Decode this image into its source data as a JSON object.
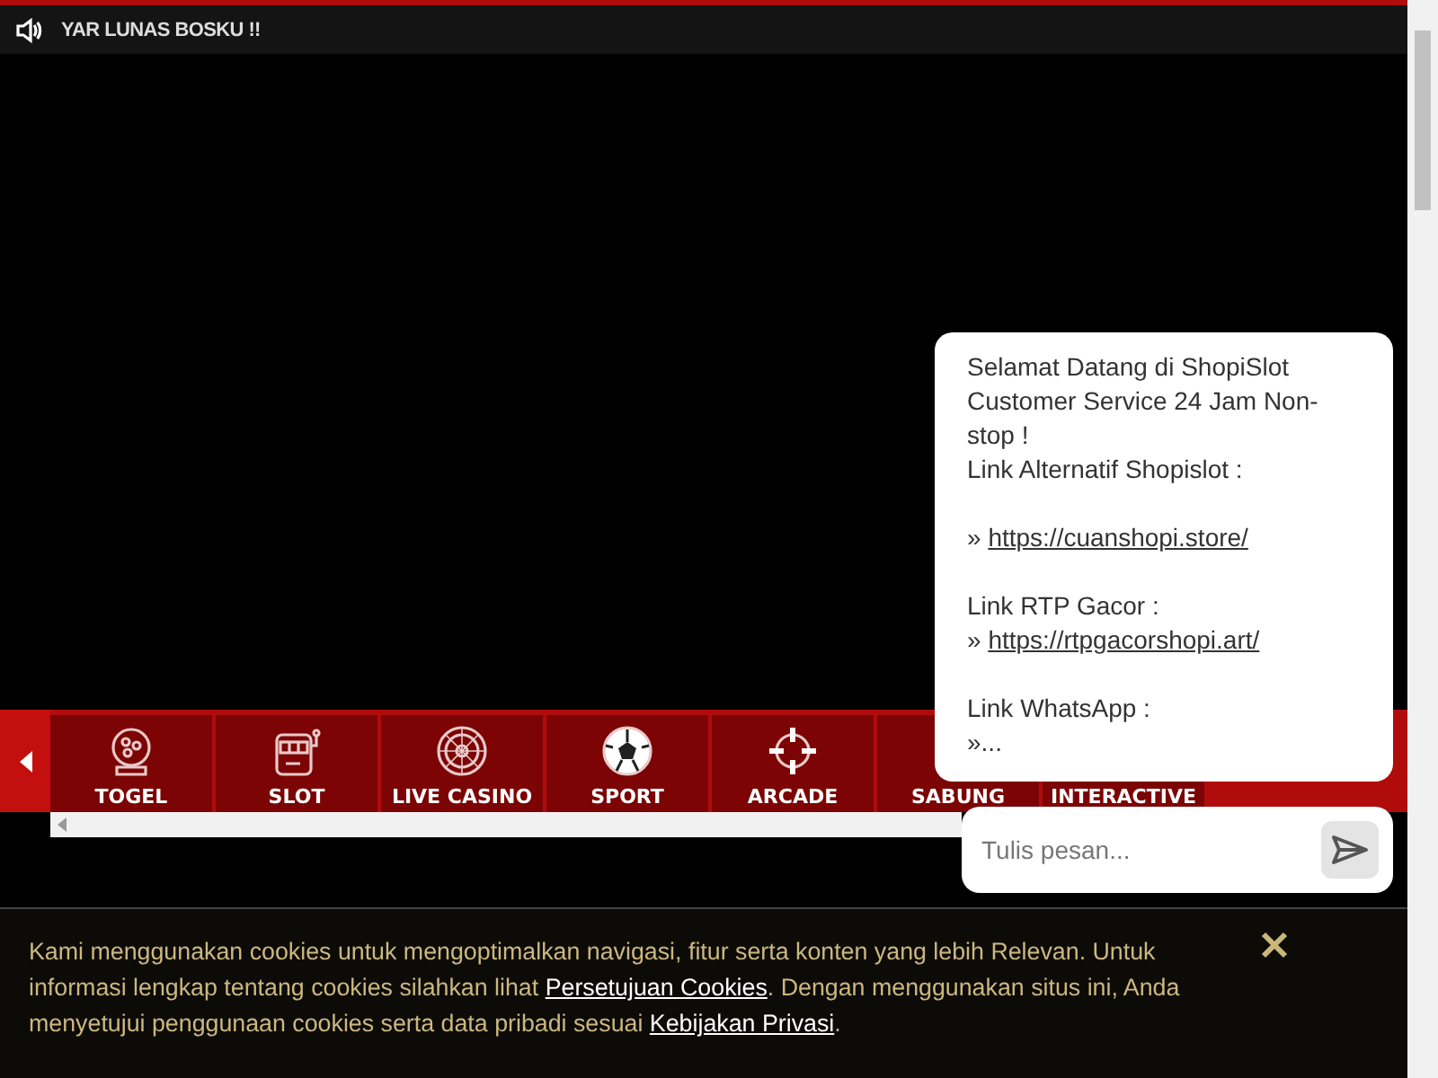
{
  "marquee": {
    "text": "YAR LUNAS BOSKU !!"
  },
  "categories": [
    {
      "kind": "togel",
      "label": "TOGEL"
    },
    {
      "kind": "slot",
      "label": "SLOT"
    },
    {
      "kind": "casino",
      "label": "LIVE CASINO"
    },
    {
      "kind": "sport",
      "label": "SPORT"
    },
    {
      "kind": "arcade",
      "label": "ARCADE"
    },
    {
      "kind": "sabung",
      "label": "SABUNG"
    },
    {
      "kind": "interactive",
      "label": "INTERACTIVE"
    }
  ],
  "chat": {
    "message": [
      {
        "kind": "text",
        "text": "Selamat Datang di ShopiSlot Customer Service 24 Jam Non-stop !"
      },
      {
        "kind": "text",
        "text": "Link Alternatif Shopislot :"
      },
      {
        "kind": "blank"
      },
      {
        "kind": "link",
        "prefix": "»",
        "text": "https://cuanshopi.store/"
      },
      {
        "kind": "blank"
      },
      {
        "kind": "text",
        "text": "Link RTP Gacor :"
      },
      {
        "kind": "link",
        "prefix": "»",
        "text": "https://rtpgacorshopi.art/"
      },
      {
        "kind": "blank"
      },
      {
        "kind": "text",
        "text": "Link WhatsApp :"
      },
      {
        "kind": "text",
        "text": "»..."
      }
    ],
    "input": {
      "placeholder": "Tulis pesan..."
    }
  },
  "cookie_notice": {
    "parts": [
      {
        "kind": "text",
        "text": "Kami menggunakan cookies untuk mengoptimalkan navigasi, fitur serta konten yang lebih Relevan. Untuk informasi lengkap tentang cookies silahkan lihat "
      },
      {
        "kind": "link",
        "text": "Persetujuan Cookies"
      },
      {
        "kind": "text",
        "text": ". Dengan menggunakan situs ini, Anda menyetujui penggunaan cookies serta data pribadi sesuai "
      },
      {
        "kind": "link",
        "text": "Kebijakan Privasi"
      },
      {
        "kind": "text",
        "text": "."
      }
    ]
  }
}
